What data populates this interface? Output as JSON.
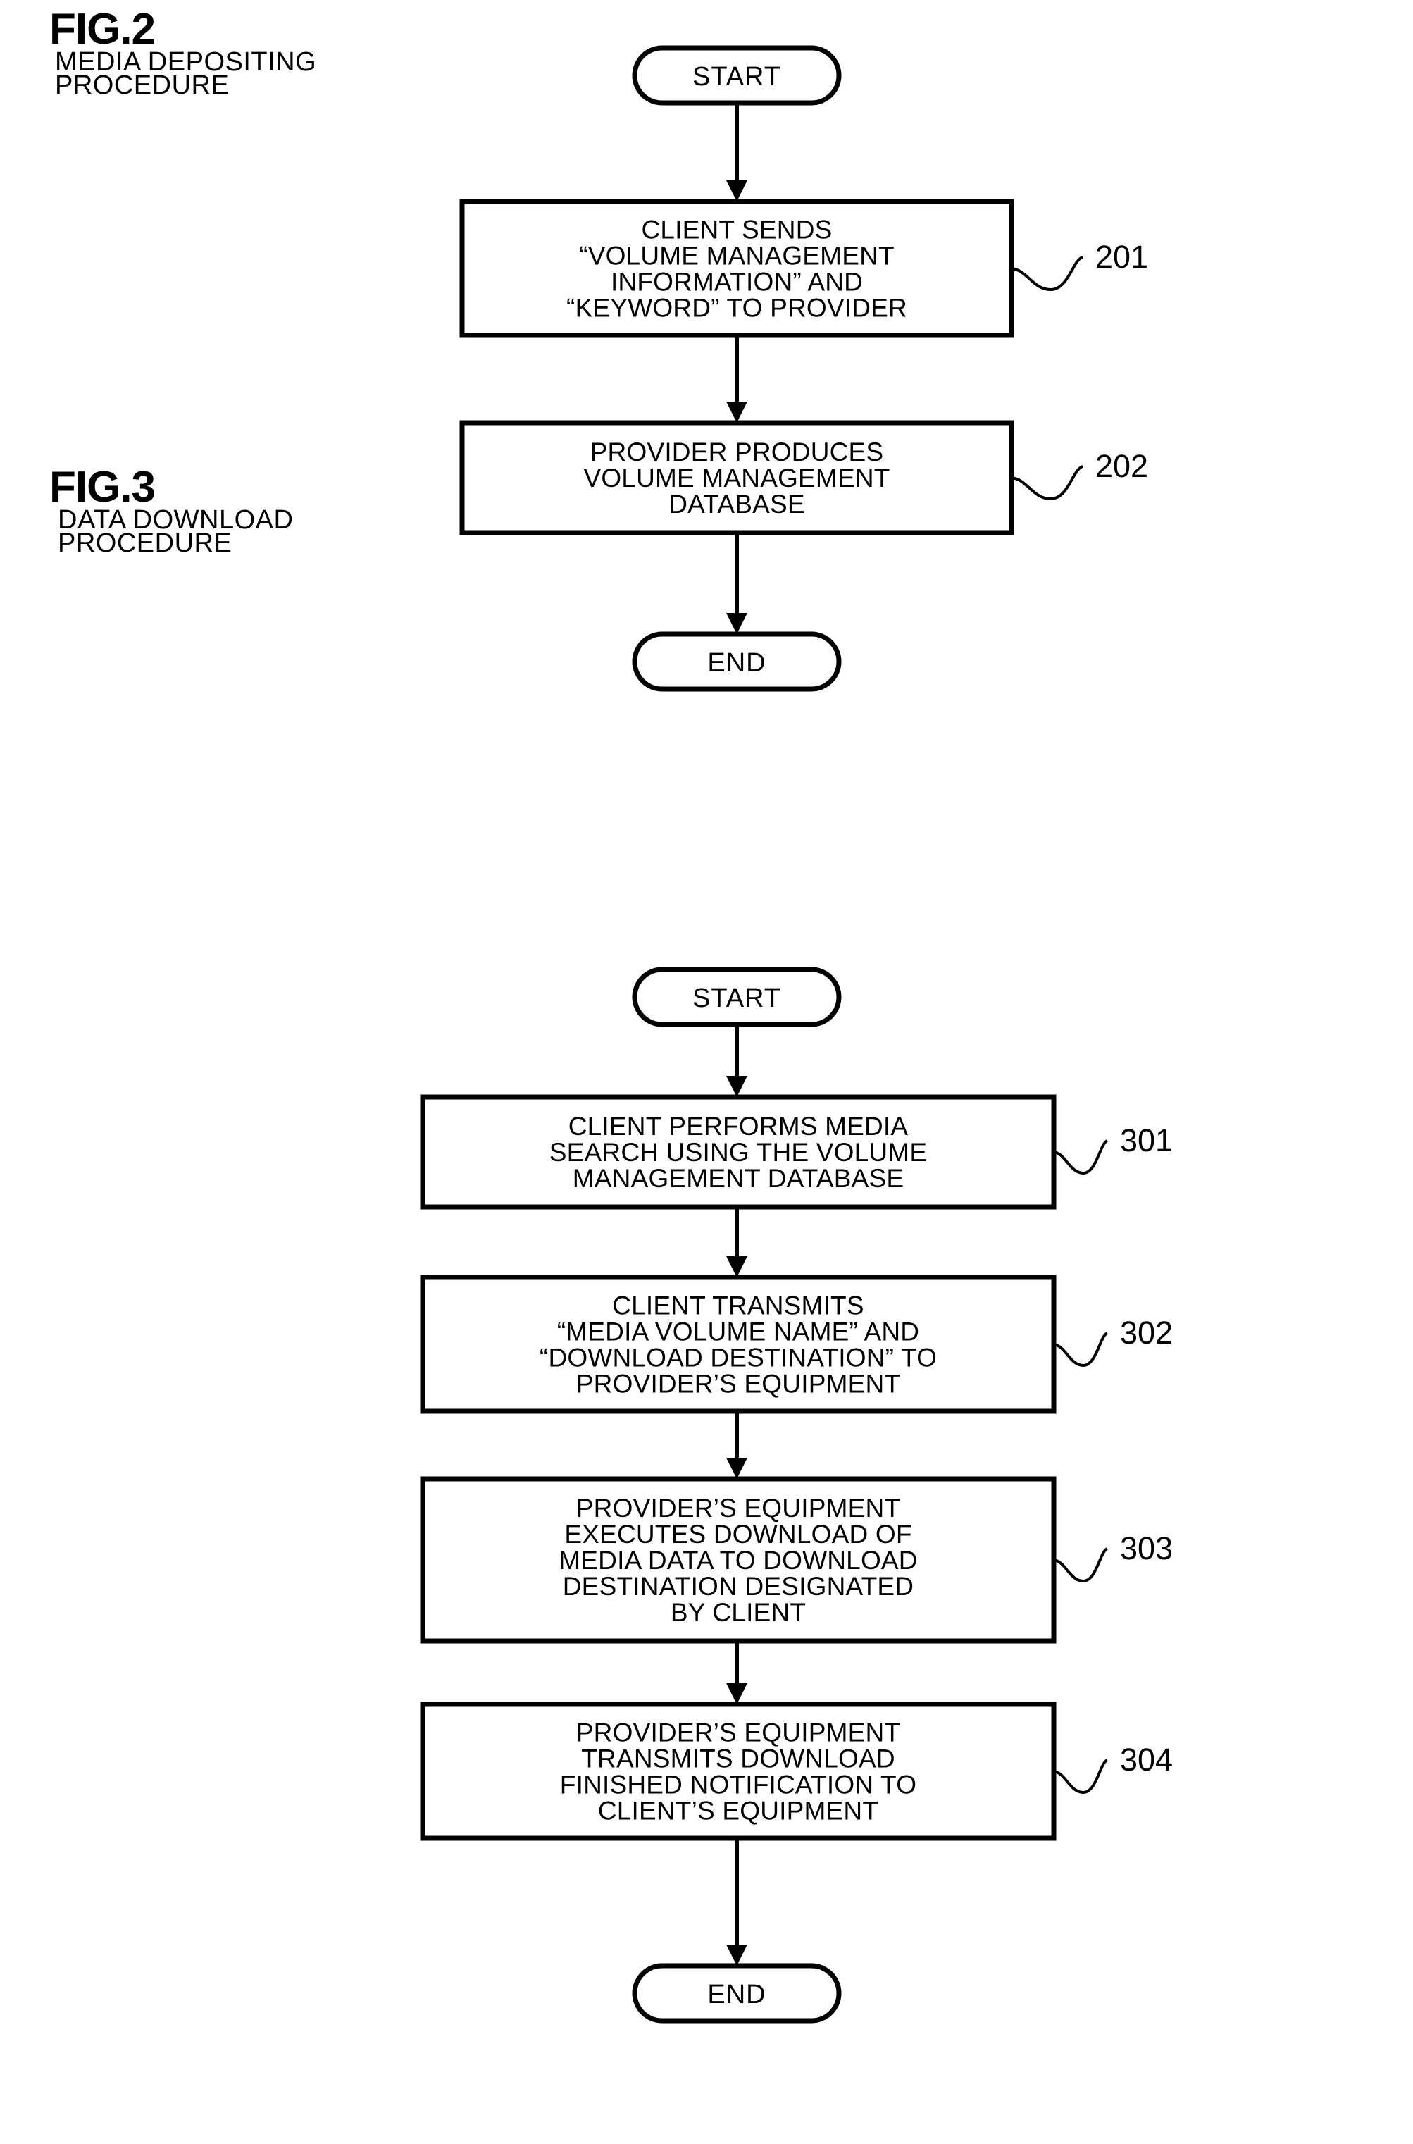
{
  "document": {
    "type": "patent-flowchart-sheet",
    "figures": [
      {
        "id": "fig2",
        "label": "FIG.2",
        "subtitle_lines": [
          "MEDIA DEPOSITING",
          "PROCEDURE"
        ],
        "start_label": "START",
        "end_label": "END",
        "steps": [
          {
            "ref": "201",
            "lines": [
              "CLIENT SENDS",
              "“VOLUME MANAGEMENT",
              "INFORMATION” AND",
              "“KEYWORD” TO PROVIDER"
            ]
          },
          {
            "ref": "202",
            "lines": [
              "PROVIDER PRODUCES",
              "VOLUME MANAGEMENT",
              "DATABASE"
            ]
          }
        ]
      },
      {
        "id": "fig3",
        "label": "FIG.3",
        "subtitle_lines": [
          "DATA DOWNLOAD",
          "PROCEDURE"
        ],
        "start_label": "START",
        "end_label": "END",
        "steps": [
          {
            "ref": "301",
            "lines": [
              "CLIENT PERFORMS MEDIA",
              "SEARCH  USING THE VOLUME",
              "MANAGEMENT DATABASE"
            ]
          },
          {
            "ref": "302",
            "lines": [
              "CLIENT TRANSMITS",
              "“MEDIA VOLUME NAME” AND",
              "“DOWNLOAD DESTINATION” TO",
              "PROVIDER’S EQUIPMENT"
            ]
          },
          {
            "ref": "303",
            "lines": [
              "PROVIDER’S EQUIPMENT",
              "EXECUTES DOWNLOAD OF",
              "MEDIA DATA TO DOWNLOAD",
              "DESTINATION DESIGNATED",
              "BY CLIENT"
            ]
          },
          {
            "ref": "304",
            "lines": [
              "PROVIDER’S EQUIPMENT",
              "TRANSMITS DOWNLOAD",
              "FINISHED NOTIFICATION TO",
              "CLIENT’S EQUIPMENT"
            ]
          }
        ]
      }
    ],
    "colors": {
      "ink": "#000000",
      "paper": "#ffffff"
    }
  }
}
